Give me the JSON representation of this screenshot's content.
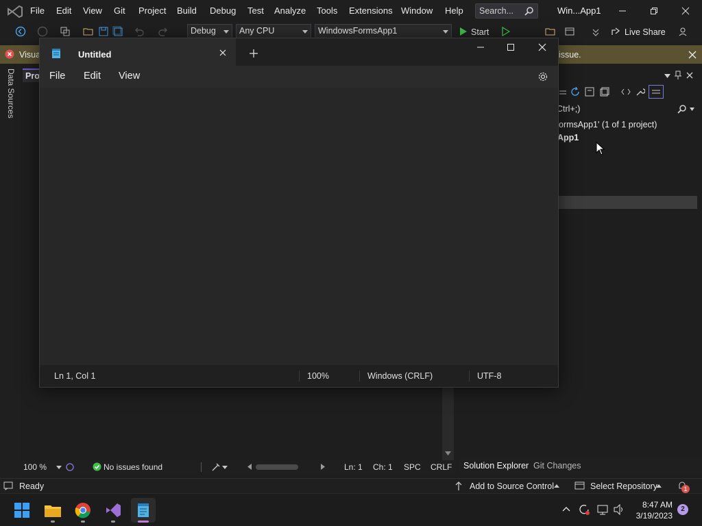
{
  "vs": {
    "menu": [
      "File",
      "Edit",
      "View",
      "Git",
      "Project",
      "Build",
      "Debug",
      "Test",
      "Analyze",
      "Tools",
      "Extensions",
      "Window",
      "Help"
    ],
    "search_placeholder": "Search...",
    "window_title": "Win...App1",
    "toolbar": {
      "config": "Debug",
      "platform": "Any CPU",
      "startup_project": "WindowsFormsApp1",
      "start_label": "Start",
      "live_share": "Live Share"
    },
    "infobar": {
      "text_left": "Visual",
      "text_right": "issue."
    },
    "data_sources": "Data Sources",
    "editor": {
      "tab_label": "Proj",
      "zoom": "100 %",
      "issues": "No issues found",
      "ln": "Ln: 1",
      "ch": "Ch: 1",
      "spc": "SPC",
      "crlf": "CRLF"
    },
    "solution_explorer": {
      "search_hint": "Ctrl+;)",
      "solution_line": "ormsApp1' (1 of 1 project)",
      "project_line": "App1",
      "tabs": [
        "Solution Explorer",
        "Git Changes"
      ]
    },
    "status": {
      "ready": "Ready",
      "add_to_source": "Add to Source Control",
      "select_repo": "Select Repository",
      "notifications": "1"
    }
  },
  "notepad": {
    "tab_title": "Untitled",
    "menu": [
      "File",
      "Edit",
      "View"
    ],
    "content": "",
    "status": {
      "position": "Ln 1, Col 1",
      "zoom": "100%",
      "line_ending": "Windows (CRLF)",
      "encoding": "UTF-8"
    }
  },
  "taskbar": {
    "time": "8:47 AM",
    "date": "3/19/2023",
    "notification_count": "2"
  }
}
